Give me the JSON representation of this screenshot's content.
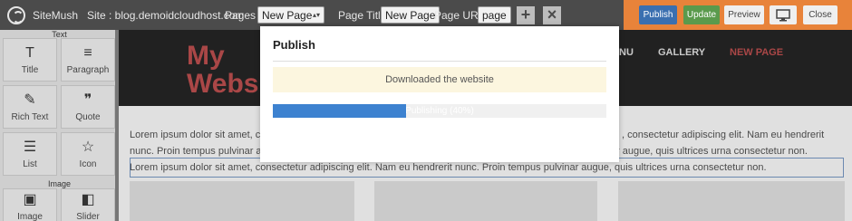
{
  "app": {
    "name": "SiteMush"
  },
  "toolbar": {
    "site_label": "Site : blog.demoidcloudhost.com",
    "pages_label": "Pages :",
    "pages_selected": "New Page",
    "page_title_label": "Page Title:",
    "page_title_value": "New Page",
    "page_url_label": "Page URL:",
    "page_url_value": "page",
    "add_symbol": "+",
    "remove_symbol": "×",
    "publish": "Publish",
    "update": "Update",
    "preview": "Preview",
    "close": "Close",
    "colors": {
      "publish_bg": "#3a6fb0",
      "update_bg": "#5a9a4c",
      "orange": "#e8833a"
    }
  },
  "sidebar": {
    "categories": {
      "text": "Text",
      "image": "Image"
    },
    "tiles": [
      {
        "label": "Title",
        "icon": "title-icon",
        "glyph": "T"
      },
      {
        "label": "Paragraph",
        "icon": "paragraph-icon",
        "glyph": "≡"
      },
      {
        "label": "Rich Text",
        "icon": "edit-icon",
        "glyph": "✎"
      },
      {
        "label": "Quote",
        "icon": "quote-icon",
        "glyph": "❞"
      },
      {
        "label": "List",
        "icon": "list-icon",
        "glyph": "☰"
      },
      {
        "label": "Icon",
        "icon": "star-icon",
        "glyph": "☆"
      },
      {
        "label": "Image",
        "icon": "image-icon",
        "glyph": "▣"
      },
      {
        "label": "Slider",
        "icon": "slider-icon",
        "glyph": "◧"
      }
    ]
  },
  "site": {
    "brand_line1": "My",
    "brand_line2": "Websi",
    "nav_partial": "NU",
    "nav_gallery": "GALLERY",
    "nav_new_page": "NEW PAGE",
    "lorem1_left": "Lorem ipsum dolor sit amet, c",
    "lorem1_right": ", consectetur adipiscing elit. Nam eu hendrerit",
    "lorem2_left": "nunc. Proin tempus pulvinar a",
    "lorem2_right": "r augue, quis ultrices urna consectetur non.",
    "lorem3": "Lorem ipsum dolor sit amet, consectetur adipiscing elit. Nam eu hendrerit nunc. Proin tempus pulvinar augue, quis ultrices urna consectetur non."
  },
  "modal": {
    "title": "Publish",
    "message": "Downloaded the website",
    "progress_label": "Publishing (40%)",
    "progress_percent": 40
  }
}
